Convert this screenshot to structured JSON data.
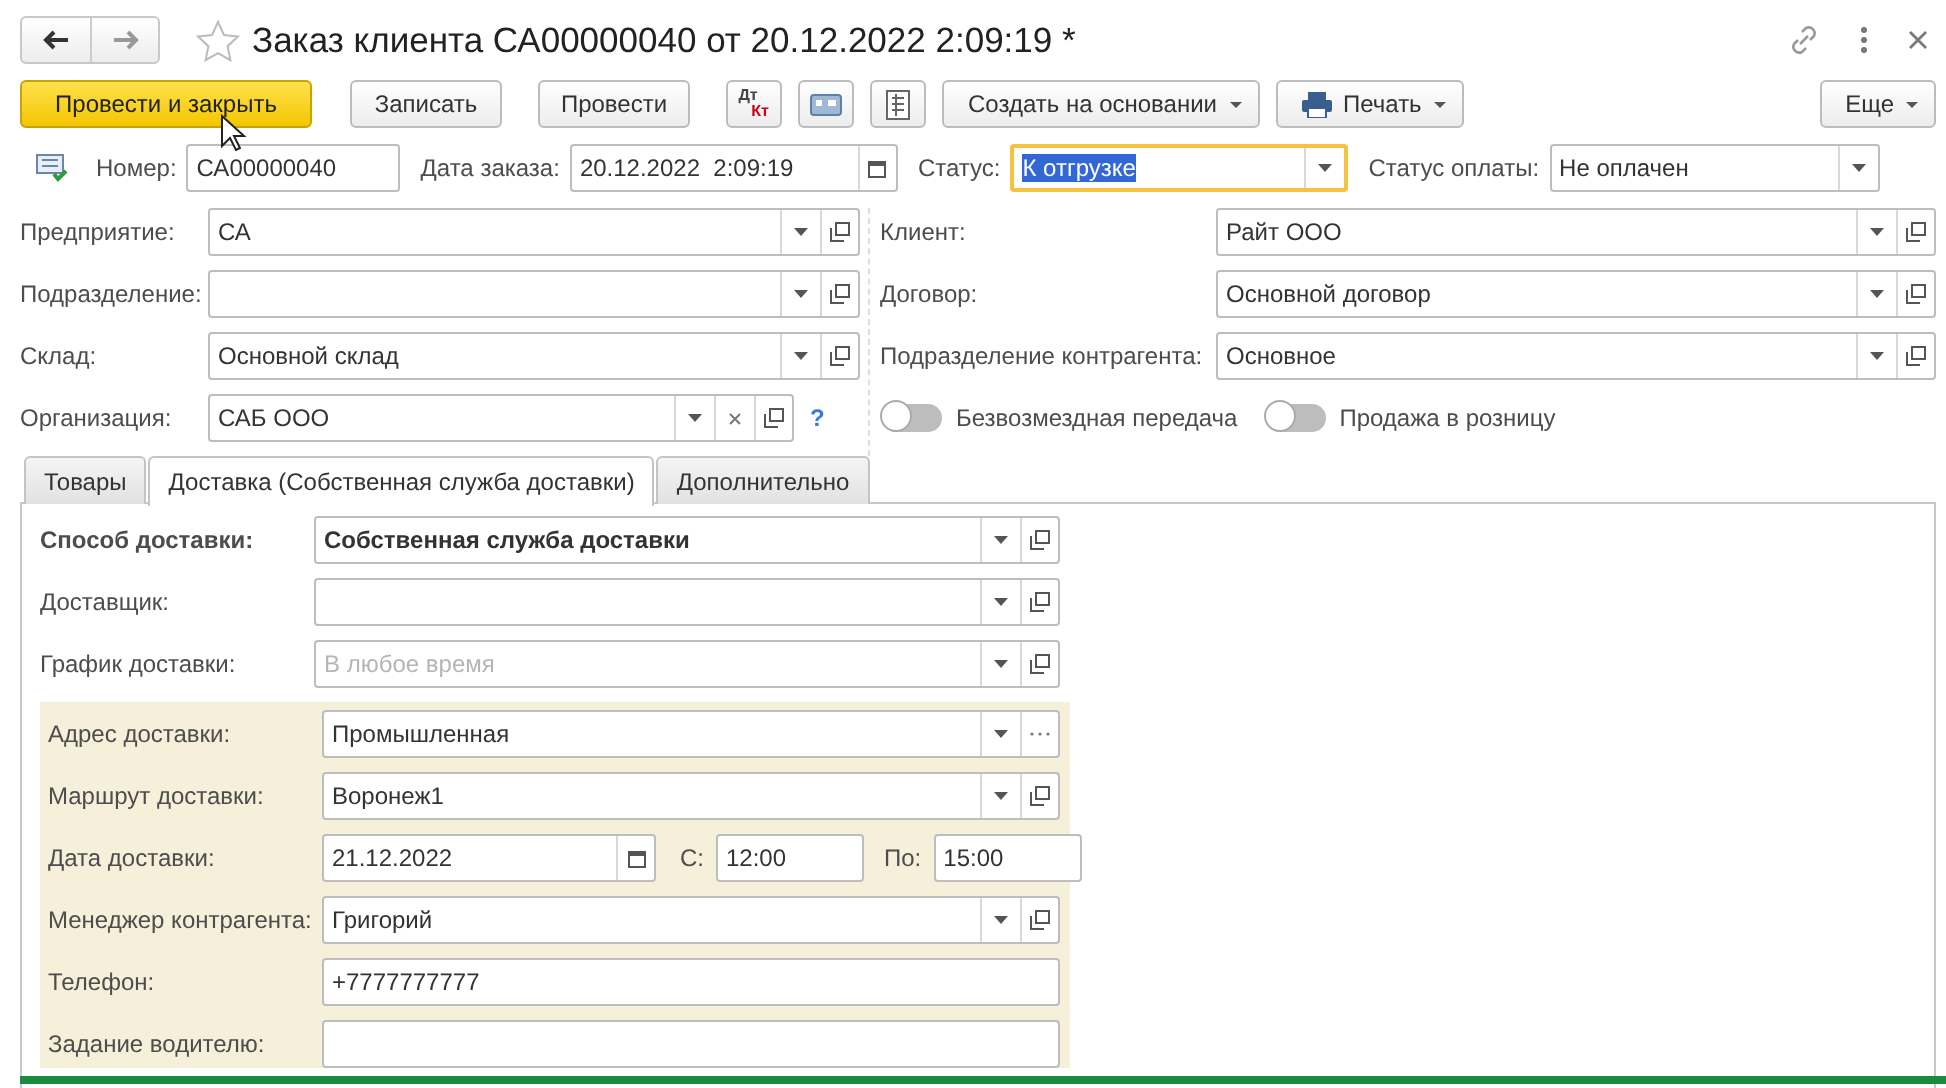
{
  "window": {
    "title": "Заказ клиента СА00000040 от 20.12.2022 2:09:19 *",
    "favorite": false
  },
  "toolbar": [
    {
      "kind": "primary",
      "label": "Провести и закрыть"
    },
    {
      "kind": "text",
      "label": "Записать"
    },
    {
      "kind": "text",
      "label": "Провести"
    },
    {
      "kind": "dt-kt",
      "top": "Дт",
      "bottom": "Кт"
    },
    {
      "kind": "card"
    },
    {
      "kind": "list"
    },
    {
      "kind": "menu",
      "label": "Создать на основании"
    },
    {
      "kind": "print",
      "label": "Печать"
    },
    {
      "kind": "more",
      "label": "Еще"
    }
  ],
  "header": [
    {
      "label": "Номер:",
      "value": "СА00000040",
      "kind": "text",
      "focused": false
    },
    {
      "label": "Дата заказа:",
      "value": "20.12.2022  2:09:19",
      "kind": "date",
      "focused": false
    },
    {
      "label": "Статус:",
      "value": "К отгрузке",
      "kind": "select",
      "focused": true
    },
    {
      "label": "Статус оплаты:",
      "value": "Не оплачен",
      "kind": "select",
      "focused": false
    }
  ],
  "left_fields": [
    {
      "label": "Предприятие:",
      "value": "СА",
      "kind": "select-open"
    },
    {
      "label": "Подразделение:",
      "kind": "select-open"
    },
    {
      "label": "Склад:",
      "value": "Основной склад",
      "kind": "select-open"
    },
    {
      "label": "Организация:",
      "value": "САБ ООО",
      "kind": "select-clear-open",
      "help": "?"
    }
  ],
  "right_fields": [
    {
      "label": "Клиент:",
      "value": "Райт ООО",
      "kind": "select-open"
    },
    {
      "label": "Договор:",
      "value": "Основной договор",
      "kind": "select-open"
    },
    {
      "label": "Подразделение контрагента:",
      "value": "Основное",
      "kind": "select-open"
    }
  ],
  "toggles": [
    {
      "label": "Безвозмездная передача",
      "on": false
    },
    {
      "label": "Продажа в розницу",
      "on": false
    }
  ],
  "tabs": [
    {
      "label": "Товары",
      "selected": false
    },
    {
      "label": "Доставка (Собственная служба доставки)",
      "selected": true
    },
    {
      "label": "Дополнительно",
      "selected": false
    }
  ],
  "delivery": [
    {
      "label": "Способ доставки:",
      "value": "Собственная служба доставки",
      "kind": "select-open",
      "bold": true
    },
    {
      "label": "Доставщик:",
      "kind": "select-open",
      "bold": false
    },
    {
      "label": "График доставки:",
      "placeholder": "В любое время",
      "kind": "select-open",
      "bold": false
    }
  ],
  "delivery_group": [
    {
      "label": "Адрес доставки:",
      "value": "Промышленная",
      "kind": "select-more"
    },
    {
      "label": "Маршрут доставки:",
      "value": "Воронеж1",
      "kind": "select-open"
    },
    {
      "label": "Дата доставки:",
      "value": "21.12.2022",
      "kind": "date-range",
      "from_label": "С:",
      "from": "12:00",
      "to_label": "По:",
      "to": "15:00"
    },
    {
      "label": "Менеджер контрагента:",
      "value": "Григорий",
      "kind": "select-open"
    },
    {
      "label": "Телефон:",
      "value": "+7777777777",
      "kind": "text"
    },
    {
      "label": "Задание водителю:",
      "kind": "textarea"
    }
  ]
}
